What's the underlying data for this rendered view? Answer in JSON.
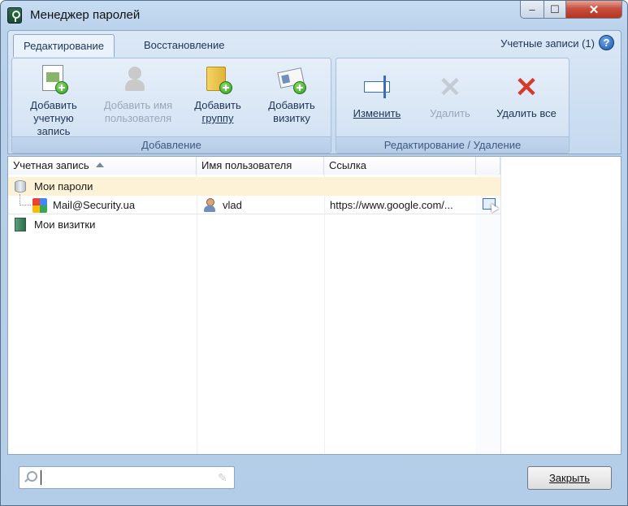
{
  "window": {
    "title": "Менеджер паролей",
    "controls": {
      "minimize": "–",
      "maximize": "☐",
      "close": "✕"
    }
  },
  "ribbon": {
    "tabs": [
      {
        "label": "Редактирование",
        "active": true
      },
      {
        "label": "Восстановление",
        "active": false
      }
    ],
    "accounts_count": "Учетные записи (1)",
    "help_icon": "?",
    "groups": [
      {
        "caption": "Добавление",
        "buttons": [
          {
            "line1": "Добавить",
            "line2": "учетную",
            "line3": "запись",
            "icon": "add-account-icon",
            "enabled": true
          },
          {
            "line1": "Добавить имя",
            "line2": "пользователя",
            "icon": "add-user-icon",
            "enabled": false
          },
          {
            "line1": "Добавить",
            "line2": "группу",
            "icon": "add-group-icon",
            "enabled": true
          },
          {
            "line1": "Добавить",
            "line2": "визитку",
            "icon": "add-card-icon",
            "enabled": true
          }
        ]
      },
      {
        "caption": "Редактирование / Удаление",
        "buttons": [
          {
            "label": "Изменить",
            "icon": "edit-icon",
            "enabled": true
          },
          {
            "label": "Удалить",
            "icon": "delete-icon",
            "enabled": false
          },
          {
            "label": "Удалить все",
            "icon": "delete-all-icon",
            "enabled": true
          }
        ]
      }
    ]
  },
  "table": {
    "columns": [
      "Учетная запись",
      "Имя пользователя",
      "Ссылка"
    ],
    "rows": {
      "group1": {
        "label": "Мои пароли",
        "icon": "database-icon"
      },
      "account": {
        "name": "Mail@Security.ua",
        "username": "vlad",
        "link": "https://www.google.com/...",
        "icon": "google-icon"
      },
      "group2": {
        "label": "Мои визитки",
        "icon": "cards-icon"
      }
    },
    "colors": {
      "group_row": "#fdf1d6",
      "header_border": "#d5dde7"
    }
  },
  "footer": {
    "search_value": "",
    "close_label": "Закрыть"
  }
}
